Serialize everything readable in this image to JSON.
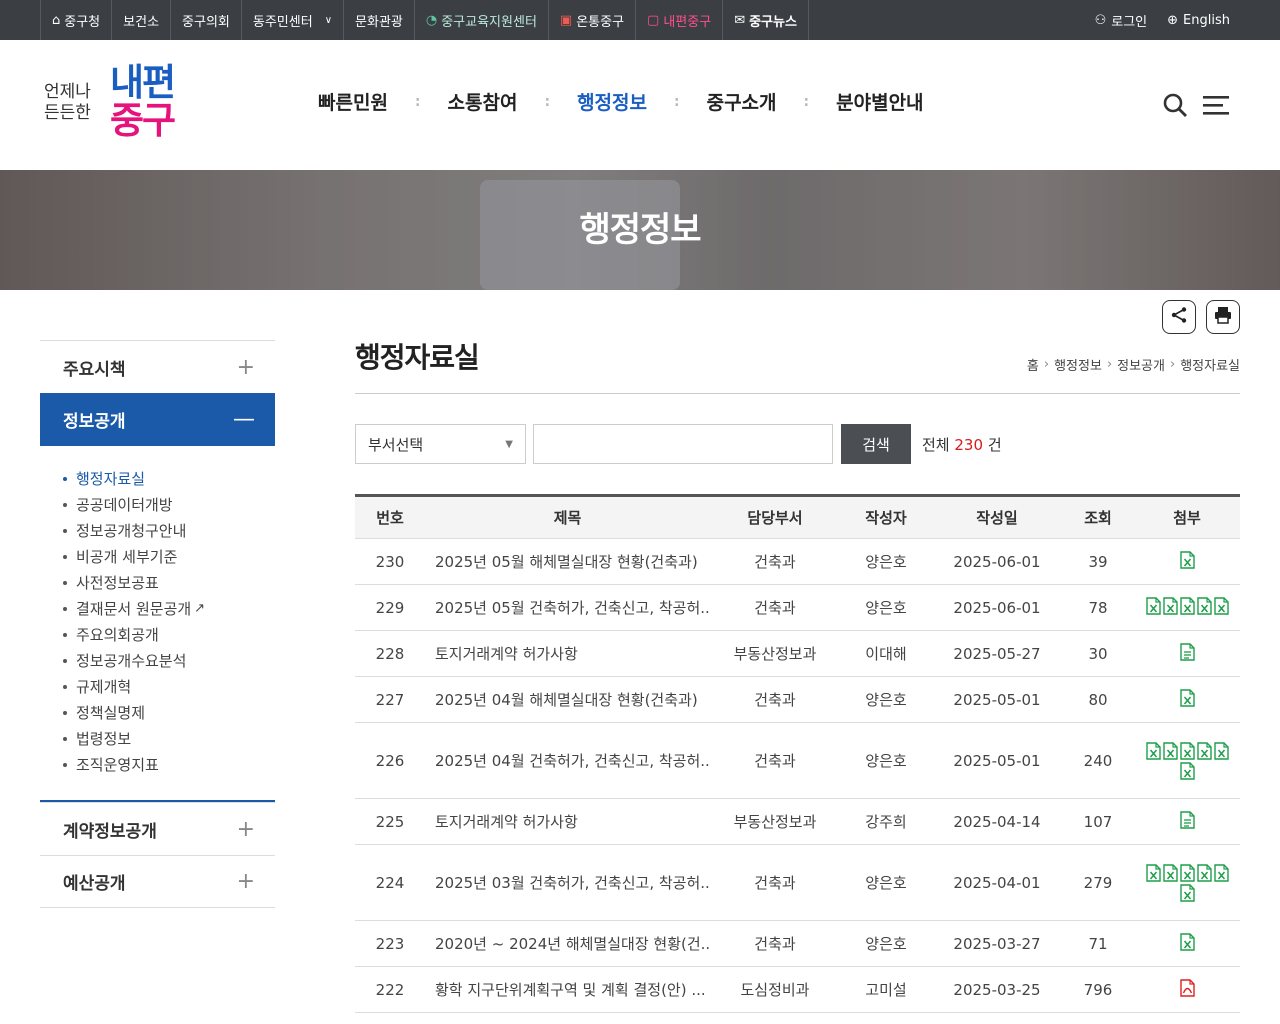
{
  "topbar": {
    "links": [
      {
        "label": "중구청",
        "icon": "home-icon"
      },
      {
        "label": "보건소"
      },
      {
        "label": "중구의회"
      },
      {
        "label": "동주민센터",
        "icon": "chevron-down-icon"
      },
      {
        "label": "문화관광"
      },
      {
        "label": "중구교육지원센터",
        "icon": "edu-logo-icon"
      },
      {
        "label": "온통중구",
        "icon": "ontong-logo-icon"
      },
      {
        "label": "내편중구",
        "icon": "naepyeon-logo-icon"
      },
      {
        "label": "중구뉴스",
        "icon": "news-icon"
      }
    ],
    "login": "로그인",
    "english": "English"
  },
  "logo": {
    "small1": "언제나",
    "small2": "든든한",
    "big1": "내편",
    "big2": "중구"
  },
  "gnb": [
    {
      "label": "빠른민원"
    },
    {
      "label": "소통참여"
    },
    {
      "label": "행정정보",
      "active": true
    },
    {
      "label": "중구소개"
    },
    {
      "label": "분야별안내"
    }
  ],
  "banner": {
    "title": "행정정보"
  },
  "sidebar": {
    "menus": [
      {
        "label": "주요시책"
      },
      {
        "label": "정보공개"
      },
      {
        "label": "계약정보공개"
      },
      {
        "label": "예산공개"
      }
    ],
    "sub": [
      "행정자료실",
      "공공데이터개방",
      "정보공개청구안내",
      "비공개 세부기준",
      "사전정보공표",
      "결재문서 원문공개",
      "주요의회공개",
      "정보공개수요분석",
      "규제개혁",
      "정책실명제",
      "법령정보",
      "조직운영지표"
    ]
  },
  "page": {
    "title": "행정자료실",
    "breadcrumb": [
      "홈",
      "행정정보",
      "정보공개",
      "행정자료실"
    ]
  },
  "search": {
    "dept_select": "부서선택",
    "button": "검색",
    "total_prefix": "전체",
    "total_count": "230",
    "total_suffix": "건"
  },
  "table": {
    "headers": [
      "번호",
      "제목",
      "담당부서",
      "작성자",
      "작성일",
      "조회",
      "첨부"
    ],
    "rows": [
      {
        "no": "230",
        "title": "2025년 05월 해체멸실대장 현황(건축과)",
        "dept": "건축과",
        "writer": "양은호",
        "date": "2025-06-01",
        "views": "39",
        "files": [
          "xls"
        ]
      },
      {
        "no": "229",
        "title": "2025년 05월 건축허가, 건축신고, 착공허...",
        "dept": "건축과",
        "writer": "양은호",
        "date": "2025-06-01",
        "views": "78",
        "files": [
          "xls",
          "xls",
          "xls",
          "xls",
          "xls"
        ]
      },
      {
        "no": "228",
        "title": "토지거래계약 허가사항",
        "dept": "부동산정보과",
        "writer": "이대해",
        "date": "2025-05-27",
        "views": "30",
        "files": [
          "doc"
        ]
      },
      {
        "no": "227",
        "title": "2025년 04월 해체멸실대장 현황(건축과)",
        "dept": "건축과",
        "writer": "양은호",
        "date": "2025-05-01",
        "views": "80",
        "files": [
          "xls"
        ]
      },
      {
        "no": "226",
        "title": "2025년 04월 건축허가, 건축신고, 착공허...",
        "dept": "건축과",
        "writer": "양은호",
        "date": "2025-05-01",
        "views": "240",
        "files": [
          "xls",
          "xls",
          "xls",
          "xls",
          "xls",
          "xls"
        ]
      },
      {
        "no": "225",
        "title": "토지거래계약 허가사항",
        "dept": "부동산정보과",
        "writer": "강주희",
        "date": "2025-04-14",
        "views": "107",
        "files": [
          "doc"
        ]
      },
      {
        "no": "224",
        "title": "2025년 03월 건축허가, 건축신고, 착공허...",
        "dept": "건축과",
        "writer": "양은호",
        "date": "2025-04-01",
        "views": "279",
        "files": [
          "xls",
          "xls",
          "xls",
          "xls",
          "xls",
          "xls"
        ]
      },
      {
        "no": "223",
        "title": "2020년 ~ 2024년 해체멸실대장 현황(건...",
        "dept": "건축과",
        "writer": "양은호",
        "date": "2025-03-27",
        "views": "71",
        "files": [
          "xls"
        ]
      },
      {
        "no": "222",
        "title": "황학 지구단위계획구역 및 계획 결정(안) ...",
        "dept": "도심정비과",
        "writer": "고미설",
        "date": "2025-03-25",
        "views": "796",
        "files": [
          "pdf"
        ]
      }
    ]
  },
  "colors": {
    "accent": "#1a5ec2",
    "pink": "#e5147c",
    "topbar": "#3b3f44",
    "sidebar_active": "#1a5aa8"
  }
}
